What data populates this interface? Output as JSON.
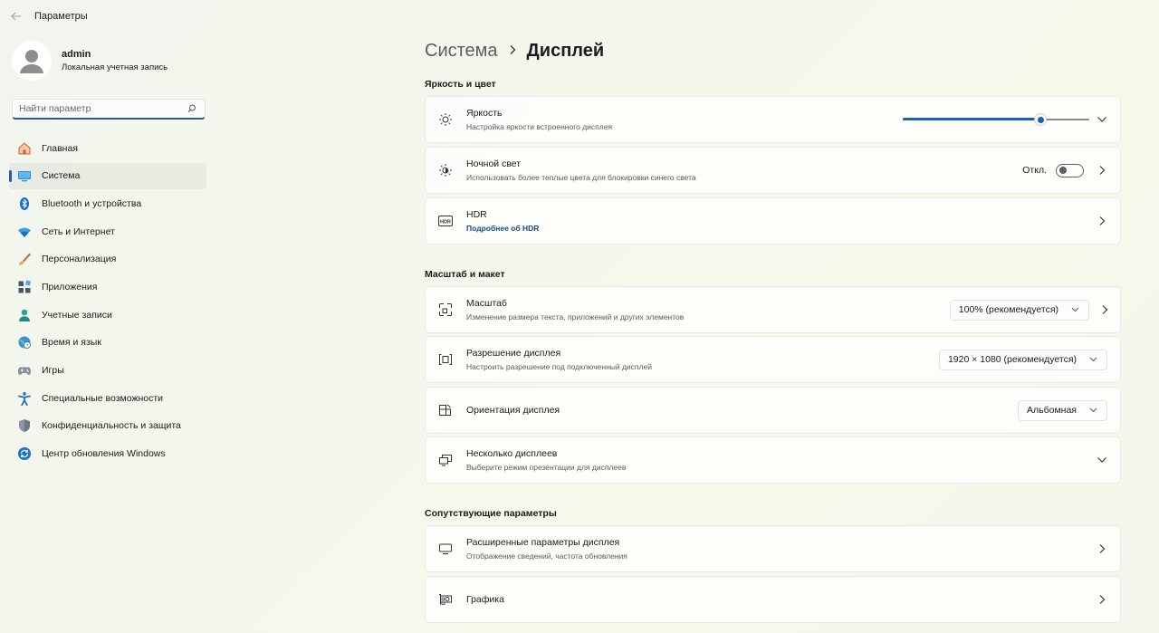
{
  "app": {
    "title": "Параметры"
  },
  "profile": {
    "name": "admin",
    "subtitle": "Локальная учетная запись"
  },
  "search": {
    "placeholder": "Найти параметр"
  },
  "sidebar": {
    "items": [
      {
        "label": "Главная",
        "icon": "home-icon"
      },
      {
        "label": "Система",
        "icon": "system-display-icon",
        "active": true
      },
      {
        "label": "Bluetooth и устройства",
        "icon": "bluetooth-icon"
      },
      {
        "label": "Сеть и Интернет",
        "icon": "wifi-icon"
      },
      {
        "label": "Персонализация",
        "icon": "brush-icon"
      },
      {
        "label": "Приложения",
        "icon": "apps-icon"
      },
      {
        "label": "Учетные записи",
        "icon": "accounts-icon"
      },
      {
        "label": "Время и язык",
        "icon": "globe-clock-icon"
      },
      {
        "label": "Игры",
        "icon": "gamepad-icon"
      },
      {
        "label": "Специальные возможности",
        "icon": "accessibility-icon"
      },
      {
        "label": "Конфиденциальность и защита",
        "icon": "shield-icon"
      },
      {
        "label": "Центр обновления Windows",
        "icon": "windows-update-icon"
      }
    ]
  },
  "breadcrumb": {
    "parent": "Система",
    "current": "Дисплей"
  },
  "sections": {
    "brightness_color": "Яркость и цвет",
    "scale_layout": "Масштаб и макет",
    "related": "Сопутствующие параметры"
  },
  "cards": {
    "brightness": {
      "title": "Яркость",
      "subtitle": "Настройка яркости встроенного дисплея",
      "value_percent": 74
    },
    "night_light": {
      "title": "Ночной свет",
      "subtitle": "Использовать более теплые цвета для блокировки синего света",
      "state_label": "Откл.",
      "on": false
    },
    "hdr": {
      "title": "HDR",
      "link": "Подробнее об HDR"
    },
    "scale": {
      "title": "Масштаб",
      "subtitle": "Изменение размера текста, приложений и других элементов",
      "value": "100% (рекомендуется)"
    },
    "resolution": {
      "title": "Разрешение дисплея",
      "subtitle": "Настроить разрешение под подключенный дисплей",
      "value": "1920 × 1080 (рекомендуется)"
    },
    "orientation": {
      "title": "Ориентация дисплея",
      "value": "Альбомная"
    },
    "multi_display": {
      "title": "Несколько дисплеев",
      "subtitle": "Выберите режим презентации для дисплеев"
    },
    "advanced": {
      "title": "Расширенные параметры дисплея",
      "subtitle": "Отображение сведений, частота обновления"
    },
    "graphics": {
      "title": "Графика"
    }
  },
  "colors": {
    "accent": "#1a5fb4"
  }
}
